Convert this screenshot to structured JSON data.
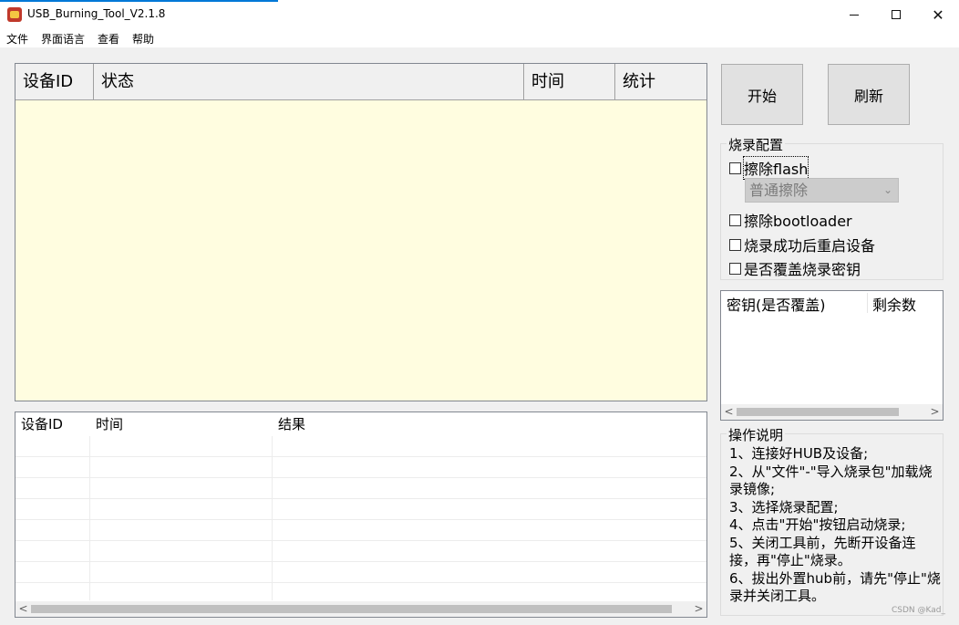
{
  "window": {
    "title": "USB_Burning_Tool_V2.1.8",
    "minimize_glyph": "",
    "maximize_glyph": "",
    "close_glyph": "✕"
  },
  "menu": [
    "文件",
    "界面语言",
    "查看",
    "帮助"
  ],
  "device_table": {
    "columns": [
      "设备ID",
      "状态",
      "时间",
      "统计"
    ],
    "background": "#fffde0"
  },
  "log_table": {
    "columns": [
      "设备ID",
      "时间",
      "结果"
    ],
    "rows": []
  },
  "buttons": {
    "start": "开始",
    "refresh": "刷新"
  },
  "burn_config": {
    "title": "烧录配置",
    "erase_flash": {
      "label": "擦除flash",
      "checked": false
    },
    "erase_mode": {
      "selected": "普通擦除",
      "enabled": false
    },
    "erase_bootloader": {
      "label": "擦除bootloader",
      "checked": false
    },
    "reboot_after": {
      "label": "烧录成功后重启设备",
      "checked": false
    },
    "overwrite_key": {
      "label": "是否覆盖烧录密钥",
      "checked": false
    }
  },
  "key_table": {
    "columns": [
      "密钥(是否覆盖)",
      "剩余数"
    ]
  },
  "instructions": {
    "title": "操作说明",
    "lines": [
      "1、连接好HUB及设备;",
      "2、从\"文件\"-\"导入烧录包\"加载烧录镜像;",
      "3、选择烧录配置;",
      "4、点击\"开始\"按钮启动烧录;",
      "5、关闭工具前，先断开设备连接，再\"停止\"烧录。",
      "6、拔出外置hub前，请先\"停止\"烧录并关闭工具。"
    ]
  },
  "watermark": "CSDN @Kad_",
  "scroll_left": "<",
  "scroll_right": ">"
}
